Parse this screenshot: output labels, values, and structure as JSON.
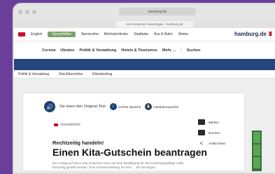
{
  "browser": {
    "url": "hamburg.de",
    "tab_label": "Kita-Gutschein beantragen - hamburg.de",
    "close_label": "Schließen"
  },
  "topnav": {
    "lang": "English",
    "pill": "Sprachhilfen",
    "items": [
      "Barrierefrei",
      "Behördenfinder",
      "Stadtplan",
      "Bus & Bahn",
      "Wetter"
    ],
    "logo_text": "hamburg.de"
  },
  "mainnav": {
    "items": [
      "Corona",
      "Ukraine",
      "Politik & Verwaltung",
      "Hotels & Tourismus",
      "Mehr ...",
      "Suchen"
    ]
  },
  "breadcrumb": {
    "items": [
      "Politik & Verwaltung",
      "Kita-Elterninfos",
      "Elternbeitrag"
    ]
  },
  "listen": {
    "label": "Sie lesen den Original-Text",
    "lang_btn": "Leichte Sprache",
    "sign_btn": "Gebärdensprache"
  },
  "article": {
    "tag": "Verwaltetinfo",
    "kicker": "Rechtzeitig handeln!",
    "title": "Einen Kita-Gutschein beantragen",
    "body": "Der Antrag auf einen Kita-Gutschein kann auf eine Bewilligung für die Kindertagespflege sollte frühzeitig gestellt werden. Eine Kostenerstattung ist nicht ... Sie benötigen..."
  },
  "tools": {
    "merken": "Merken",
    "drucken": "Drucken",
    "teilen": "Artikel teilen"
  }
}
